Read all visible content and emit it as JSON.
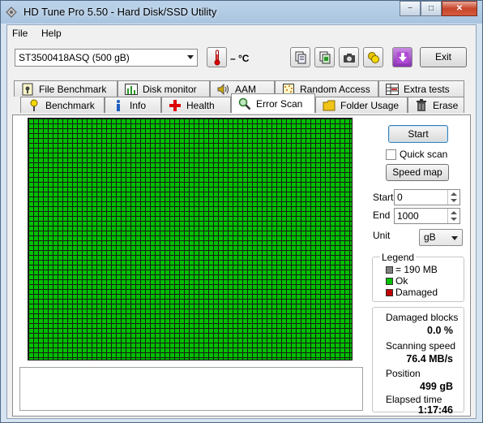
{
  "window": {
    "title": "HD Tune Pro 5.50 - Hard Disk/SSD Utility",
    "buttons": {
      "minimize": "−",
      "maximize": "□",
      "close": "✕"
    }
  },
  "menu": {
    "file": "File",
    "help": "Help"
  },
  "toolbar": {
    "drive": "ST3500418ASQ (500 gB)",
    "temperature": "– °C",
    "exit": "Exit",
    "icons": [
      "thermometer-icon",
      "copy-info-icon",
      "copy-screenshot-icon",
      "camera-icon",
      "coins-icon",
      "download-icon"
    ]
  },
  "tabs": {
    "row1": [
      "File Benchmark",
      "Disk monitor",
      "AAM",
      "Random Access",
      "Extra tests"
    ],
    "row2": [
      "Benchmark",
      "Info",
      "Health",
      "Error Scan",
      "Folder Usage",
      "Erase"
    ],
    "active": "Error Scan"
  },
  "scan": {
    "start_button": "Start",
    "quick_scan": "Quick scan",
    "quick_scan_checked": false,
    "speed_map_button": "Speed map",
    "start_label": "Start",
    "start_value": "0",
    "end_label": "End",
    "end_value": "1000",
    "unit_label": "Unit",
    "unit_value": "gB",
    "block_status": "ok"
  },
  "legend": {
    "title": "Legend",
    "items": [
      {
        "label": "= 190 MB",
        "color": "#808080"
      },
      {
        "label": "Ok",
        "color": "#00c000"
      },
      {
        "label": "Damaged",
        "color": "#c00000"
      }
    ]
  },
  "stats": {
    "damaged_label": "Damaged blocks",
    "damaged_value": "0.0 %",
    "speed_label": "Scanning speed",
    "speed_value": "76.4 MB/s",
    "position_label": "Position",
    "position_value": "499 gB",
    "elapsed_label": "Elapsed time",
    "elapsed_value": "1:17:46"
  }
}
